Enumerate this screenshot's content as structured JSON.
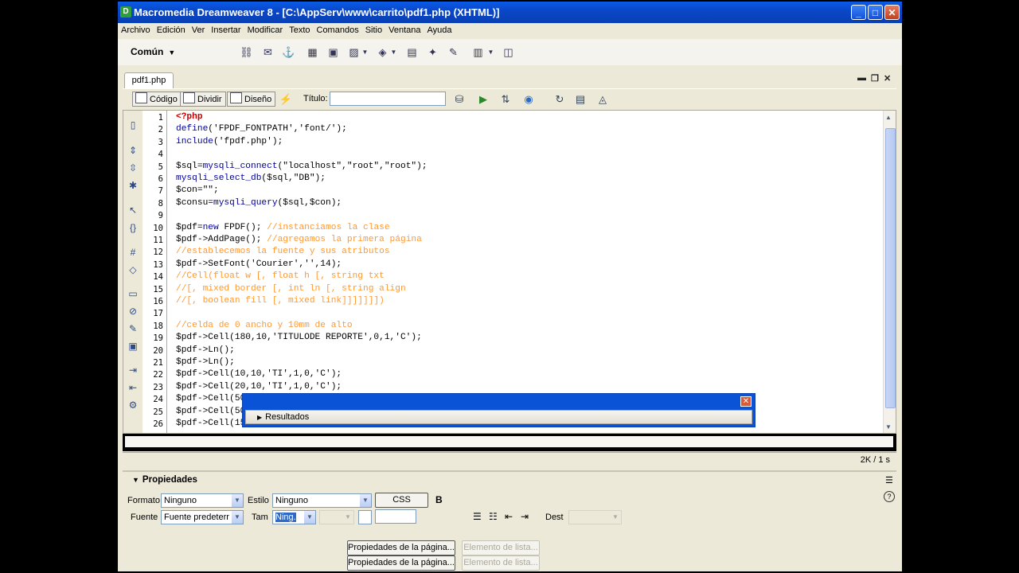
{
  "window": {
    "title": "Macromedia Dreamweaver 8 - [C:\\AppServ\\www\\carrito\\pdf1.php (XHTML)]",
    "min": "_",
    "max": "□",
    "close": "✕"
  },
  "menu": [
    "Archivo",
    "Edición",
    "Ver",
    "Insertar",
    "Modificar",
    "Texto",
    "Comandos",
    "Sitio",
    "Ventana",
    "Ayuda"
  ],
  "insert_bar": {
    "category": "Común",
    "caret": "▼"
  },
  "document": {
    "tab": "pdf1.php",
    "views": {
      "code": "Código",
      "split": "Dividir",
      "design": "Diseño"
    },
    "title_label": "Título:",
    "title_value": ""
  },
  "code_lines": [
    {
      "n": "1",
      "parts": [
        {
          "c": "kw",
          "t": "<?php"
        }
      ]
    },
    {
      "n": "2",
      "parts": [
        {
          "c": "fn",
          "t": "define"
        },
        {
          "c": "st",
          "t": "('FPDF_FONTPATH','font/');"
        }
      ]
    },
    {
      "n": "3",
      "parts": [
        {
          "c": "fn",
          "t": "include"
        },
        {
          "c": "st",
          "t": "('fpdf.php');"
        }
      ]
    },
    {
      "n": "4",
      "parts": []
    },
    {
      "n": "5",
      "parts": [
        {
          "c": "st",
          "t": "$sql="
        },
        {
          "c": "fn",
          "t": "mysqli_connect"
        },
        {
          "c": "st",
          "t": "(\"localhost\",\"root\",\"root\");"
        }
      ]
    },
    {
      "n": "6",
      "parts": [
        {
          "c": "fn",
          "t": "mysqli_select_db"
        },
        {
          "c": "st",
          "t": "($sql,\"DB\");"
        }
      ]
    },
    {
      "n": "7",
      "parts": [
        {
          "c": "st",
          "t": "$con=\"\";"
        }
      ]
    },
    {
      "n": "8",
      "parts": [
        {
          "c": "st",
          "t": "$consu="
        },
        {
          "c": "fn",
          "t": "mysqli_query"
        },
        {
          "c": "st",
          "t": "($sql,$con);"
        }
      ]
    },
    {
      "n": "9",
      "parts": []
    },
    {
      "n": "10",
      "parts": [
        {
          "c": "st",
          "t": "$pdf="
        },
        {
          "c": "fn",
          "t": "new"
        },
        {
          "c": "st",
          "t": " FPDF(); "
        },
        {
          "c": "cm",
          "t": "//instanciamos la clase"
        }
      ]
    },
    {
      "n": "11",
      "parts": [
        {
          "c": "st",
          "t": "$pdf->AddPage(); "
        },
        {
          "c": "cm",
          "t": "//agregamos la primera página"
        }
      ]
    },
    {
      "n": "12",
      "parts": [
        {
          "c": "cm",
          "t": "//establecemos la fuente y sus atributos"
        }
      ]
    },
    {
      "n": "13",
      "parts": [
        {
          "c": "st",
          "t": "$pdf->SetFont('Courier','',14);"
        }
      ]
    },
    {
      "n": "14",
      "parts": [
        {
          "c": "cm",
          "t": "//Cell(float w [, float h [, string txt"
        }
      ]
    },
    {
      "n": "15",
      "parts": [
        {
          "c": "cm",
          "t": "//[, mixed border [, int ln [, string align"
        }
      ]
    },
    {
      "n": "16",
      "parts": [
        {
          "c": "cm",
          "t": "//[, boolean fill [, mixed link]]]]]]])"
        }
      ]
    },
    {
      "n": "17",
      "parts": []
    },
    {
      "n": "18",
      "parts": [
        {
          "c": "cm",
          "t": "//celda de 0 ancho y 10mm de alto"
        }
      ]
    },
    {
      "n": "19",
      "parts": [
        {
          "c": "st",
          "t": "$pdf->Cell(180,10,'TITULODE REPORTE',0,1,'C');"
        }
      ]
    },
    {
      "n": "20",
      "parts": [
        {
          "c": "st",
          "t": "$pdf->Ln();"
        }
      ]
    },
    {
      "n": "21",
      "parts": [
        {
          "c": "st",
          "t": "$pdf->Ln();"
        }
      ]
    },
    {
      "n": "22",
      "parts": [
        {
          "c": "st",
          "t": "$pdf->Cell(10,10,'TI',1,0,'C');"
        }
      ]
    },
    {
      "n": "23",
      "parts": [
        {
          "c": "st",
          "t": "$pdf->Cell(20,10,'TI',1,0,'C');"
        }
      ]
    },
    {
      "n": "24",
      "parts": [
        {
          "c": "st",
          "t": "$pdf->Cell(50"
        }
      ]
    },
    {
      "n": "25",
      "parts": [
        {
          "c": "st",
          "t": "$pdf->Cell(50"
        }
      ]
    },
    {
      "n": "26",
      "parts": [
        {
          "c": "st",
          "t": "$pdf->Cell(15"
        }
      ]
    }
  ],
  "results_panel": {
    "label": "Resultados",
    "close": "✕",
    "arrow": "▶"
  },
  "status": {
    "size": "2K / 1 s"
  },
  "properties": {
    "header": "Propiedades",
    "format_label": "Formato",
    "format_value": "Ninguno",
    "style_label": "Estilo",
    "style_value": "Ninguno",
    "css_button": "CSS",
    "bold": "B",
    "font_label": "Fuente",
    "font_value": "Fuente predeterr",
    "size_label": "Tam",
    "size_value": "Ning.",
    "dest_label": "Dest",
    "page_props_1": "Propiedades de la página...",
    "page_props_2": "Propiedades de la página...",
    "list_item_1": "Elemento de lista...",
    "list_item_2": "Elemento de lista..."
  }
}
